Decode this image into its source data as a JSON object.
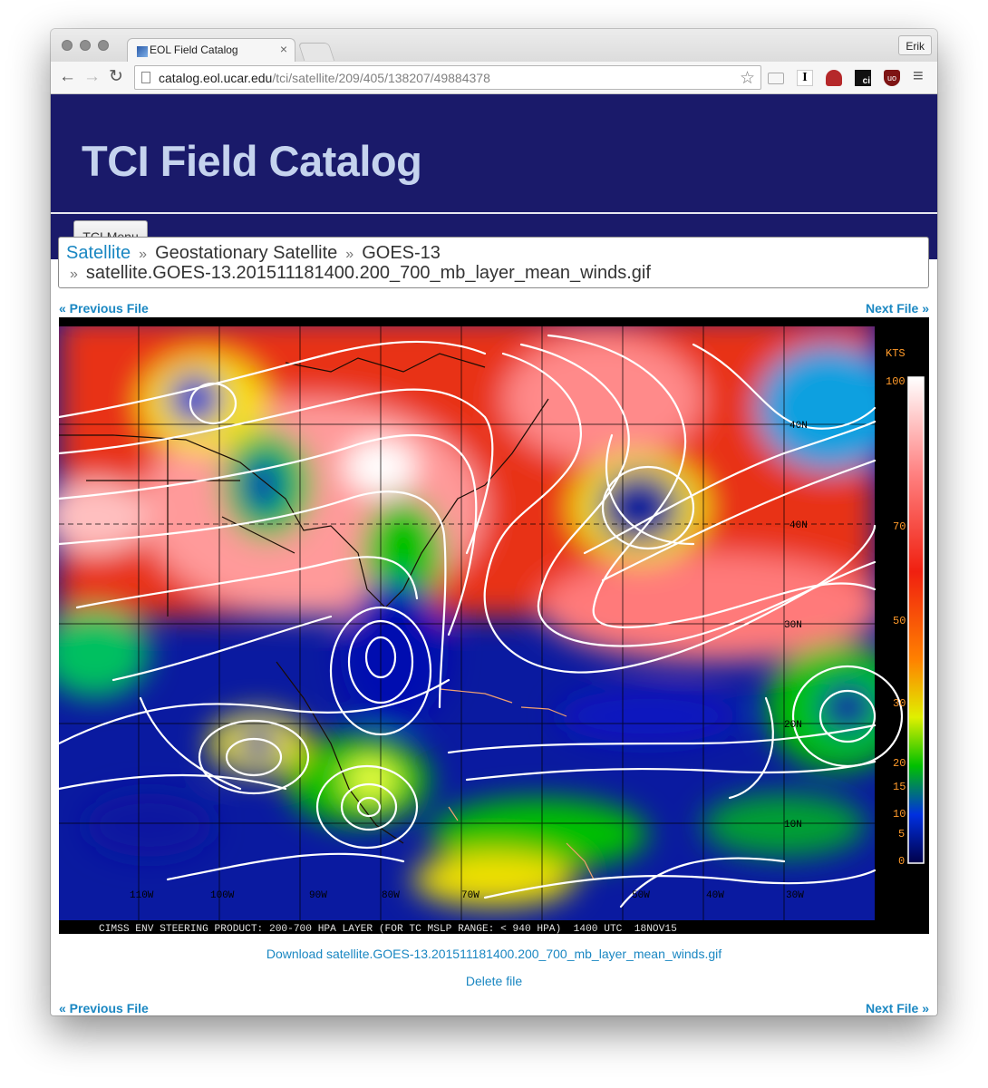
{
  "browser": {
    "tab_title": "EOL Field Catalog",
    "tab_close": "×",
    "profile_name": "Erik",
    "url_host": "catalog.eol.ucar.edu",
    "url_path": "/tci/satellite/209/405/138207/49884378",
    "nav_back": "←",
    "nav_forward": "→",
    "nav_reload": "↻",
    "star_glyph": "☆",
    "menu_glyph": "≡"
  },
  "site": {
    "title": "TCI Field Catalog",
    "menu_button": "TCI Menu"
  },
  "breadcrumb": {
    "sep": "»",
    "items": [
      "Satellite",
      "Geostationary Satellite",
      "GOES-13"
    ],
    "file": "satellite.GOES-13.201511181400.200_700_mb_layer_mean_winds.gif"
  },
  "pager": {
    "previous": "« Previous File",
    "next": "Next File »"
  },
  "image": {
    "unit": "KTS",
    "scale_labels": [
      "100",
      "70",
      "50",
      "30",
      "20",
      "15",
      "10",
      "5",
      "0"
    ],
    "lat_labels": [
      "40N",
      "30N",
      "20N",
      "10N"
    ],
    "lon_labels": [
      "110W",
      "100W",
      "90W",
      "80W",
      "70W",
      "60W",
      "50W",
      "40W",
      "30W"
    ],
    "caption": "CIMSS ENV STEERING PRODUCT: 200-700 HPA LAYER (FOR TC MSLP RANGE: < 940 HPA)  1400 UTC  18NOV15",
    "colors": {
      "label_orange": "#ff9a2a",
      "caption_white": "#e0e0e0"
    }
  },
  "actions": {
    "download": "Download satellite.GOES-13.201511181400.200_700_mb_layer_mean_winds.gif",
    "delete": "Delete file"
  },
  "theme": {
    "header_bg": "#1a1a6a",
    "title_color": "#c5d3ee",
    "link_color": "#1a87c2"
  }
}
